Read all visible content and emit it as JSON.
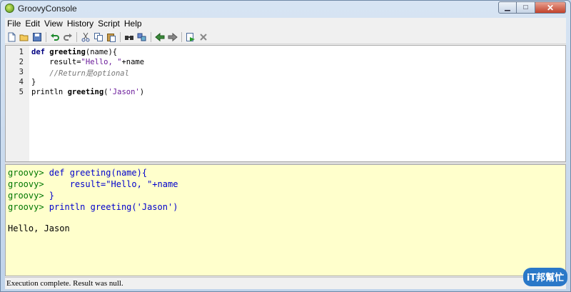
{
  "window": {
    "title": "GroovyConsole",
    "min_glyph": "▁",
    "max_glyph": "□",
    "close_glyph": "✕"
  },
  "menu": [
    "File",
    "Edit",
    "View",
    "History",
    "Script",
    "Help"
  ],
  "toolbar": {
    "icons": [
      "new-file-icon",
      "open-folder-icon",
      "save-icon",
      "undo-icon",
      "redo-icon",
      "cut-icon",
      "copy-icon",
      "paste-icon",
      "find-icon",
      "replace-icon",
      "history-previous-icon",
      "history-next-icon",
      "run-script-icon",
      "interrupt-icon"
    ]
  },
  "editor": {
    "line_numbers": [
      "1",
      "2",
      "3",
      "4",
      "5"
    ],
    "lines": [
      [
        {
          "t": "def",
          "c": "kw"
        },
        {
          "t": " "
        },
        {
          "t": "greeting",
          "c": "fn"
        },
        {
          "t": "(name){"
        }
      ],
      [
        {
          "t": "    result="
        },
        {
          "t": "\"Hello, \"",
          "c": "str"
        },
        {
          "t": "+name"
        }
      ],
      [
        {
          "t": "    "
        },
        {
          "t": "//Return是optional",
          "c": "cmt"
        }
      ],
      [
        {
          "t": "}"
        }
      ],
      [
        {
          "t": "println "
        },
        {
          "t": "greeting",
          "c": "fn"
        },
        {
          "t": "("
        },
        {
          "t": "'Jason'",
          "c": "str"
        },
        {
          "t": ")"
        }
      ]
    ]
  },
  "output": {
    "lines": [
      {
        "prompt": "groovy> ",
        "text": "def greeting(name){"
      },
      {
        "prompt": "groovy> ",
        "text": "    result=\"Hello, \"+name"
      },
      {
        "prompt": "groovy> ",
        "text": "}"
      },
      {
        "prompt": "groovy> ",
        "text": "println greeting('Jason')"
      }
    ],
    "result": "Hello, Jason"
  },
  "status": "Execution complete. Result was null.",
  "watermark": {
    "text": "iT邦幫忙"
  },
  "colors": {
    "prompt": "#007700",
    "echo": "#0000cc",
    "output_bg": "#ffffcc",
    "keyword": "#000080"
  }
}
